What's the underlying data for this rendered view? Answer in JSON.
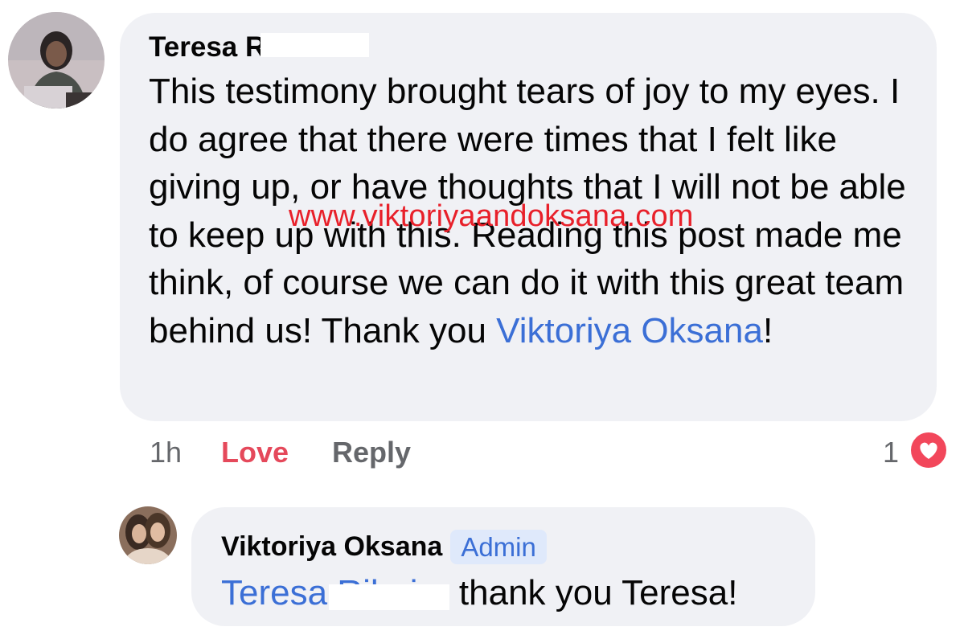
{
  "comment": {
    "author": "Teresa R",
    "text_before_mention": "This testimony brought tears of joy to my eyes. I do agree that there were times that I felt like giving up, or have thoughts that I will not be able to keep up with this. Reading this post made me think, of course we can do it with this great team behind us! Thank you ",
    "mention": "Viktoriya Oksana",
    "text_after_mention": "!",
    "watermark": "www.viktoriyaandoksana.com",
    "time": "1h",
    "love_label": "Love",
    "reply_label": "Reply",
    "reaction_count": "1",
    "reaction_icon": "heart-icon",
    "colors": {
      "mention": "#3b6fd6",
      "love": "#e5495b",
      "watermark": "#e8202a",
      "bubble": "#f0f1f5"
    }
  },
  "reply": {
    "author": "Viktoriya Oksana",
    "badge": "Admin",
    "mention": "Teresa Ribeiro",
    "text": " thank you Teresa!"
  }
}
